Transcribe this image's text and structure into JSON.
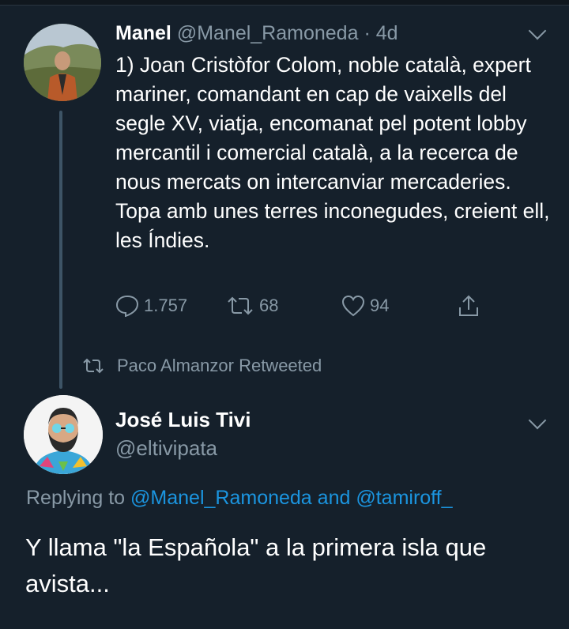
{
  "tweet1": {
    "author_name": "Manel",
    "author_handle": "@Manel_Ramoneda",
    "separator": "·",
    "time": "4d",
    "text": "1) Joan Cristòfor Colom, noble català, expert mariner, comandant en cap de vaixells del segle XV, viatja, encomanat pel potent lobby mercantil i comercial català, a la recerca de nous mercats on intercanviar mercaderies. Topa amb unes terres inconegudes, creient ell, les Índies.",
    "replies": "1.757",
    "retweets": "68",
    "likes": "94",
    "icons": {
      "reply": "reply-icon",
      "retweet": "retweet-icon",
      "like": "heart-icon",
      "share": "share-icon",
      "menu": "chevron-down-icon"
    }
  },
  "retweet_notice": {
    "text": "Paco Almanzor Retweeted",
    "icon": "retweet-icon"
  },
  "tweet2": {
    "author_name": "José Luis Tivi",
    "author_handle": "@eltivipata",
    "replying_prefix": "Replying to",
    "mention1": "@Manel_Ramoneda",
    "and_word": "and",
    "mention2": "@tamiroff_",
    "text": "Y llama \"la Española\" a la primera isla que avista..."
  },
  "colors": {
    "background": "#15202b",
    "secondary_text": "#8899a6",
    "link": "#1b95e0",
    "thread_line": "#3d5466"
  }
}
